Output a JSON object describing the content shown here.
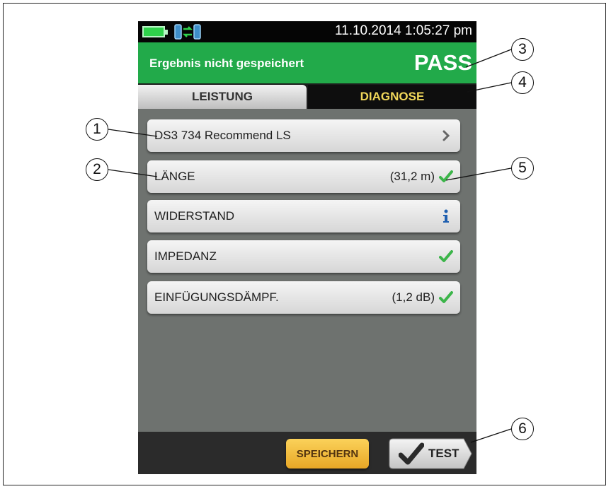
{
  "status_bar": {
    "datetime": "11.10.2014 1:05:27 pm",
    "icons": [
      "battery-icon",
      "remote-link-icon"
    ]
  },
  "header": {
    "message": "Ergebnis nicht gespeichert",
    "result": "PASS",
    "result_color": "#22aa4a"
  },
  "tabs": [
    {
      "label": "LEISTUNG",
      "selected": false
    },
    {
      "label": "DIAGNOSE",
      "selected": true
    }
  ],
  "rows": [
    {
      "label": "DS3 734 Recommend LS",
      "value": "",
      "icon": "chevron-right-icon"
    },
    {
      "label": "LÄNGE",
      "value": "(31,2 m)",
      "icon": "check-icon"
    },
    {
      "label": "WIDERSTAND",
      "value": "",
      "icon": "info-icon"
    },
    {
      "label": "IMPEDANZ",
      "value": "",
      "icon": "check-icon"
    },
    {
      "label": "EINFÜGUNGSDÄMPF.",
      "value": "(1,2 dB)",
      "icon": "check-icon"
    }
  ],
  "footer": {
    "save_label": "SPEICHERN",
    "test_label": "TEST"
  },
  "callouts": [
    "1",
    "2",
    "3",
    "4",
    "5",
    "6"
  ],
  "colors": {
    "pass_green": "#22aa4a",
    "check_green": "#3cb54a",
    "info_blue": "#1f5fb0",
    "selected_tab_text": "#f0d75a",
    "save_button": "#f2bd3a"
  }
}
